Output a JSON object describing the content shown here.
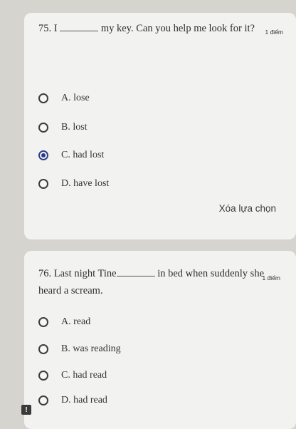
{
  "question75": {
    "number": "75.",
    "text_before": "I",
    "text_after": "my key. Can you help me look for it?",
    "points": "1 điểm",
    "options": [
      {
        "letter": "A.",
        "text": "lose",
        "selected": false
      },
      {
        "letter": "B.",
        "text": "lost",
        "selected": false
      },
      {
        "letter": "C.",
        "text": "had lost",
        "selected": true
      },
      {
        "letter": "D.",
        "text": "have lost",
        "selected": false
      }
    ],
    "clear_label": "Xóa lựa chọn"
  },
  "question76": {
    "number": "76.",
    "text_before": "Last night Tine",
    "text_after": "in bed when suddenly she heard a scream.",
    "points": "1 điểm",
    "options": [
      {
        "letter": "A.",
        "text": "read",
        "selected": false
      },
      {
        "letter": "B.",
        "text": "was reading",
        "selected": false
      },
      {
        "letter": "C.",
        "text": "had read",
        "selected": false
      },
      {
        "letter": "D.",
        "text": "had read",
        "selected": false
      }
    ]
  },
  "alert_badge": "!"
}
